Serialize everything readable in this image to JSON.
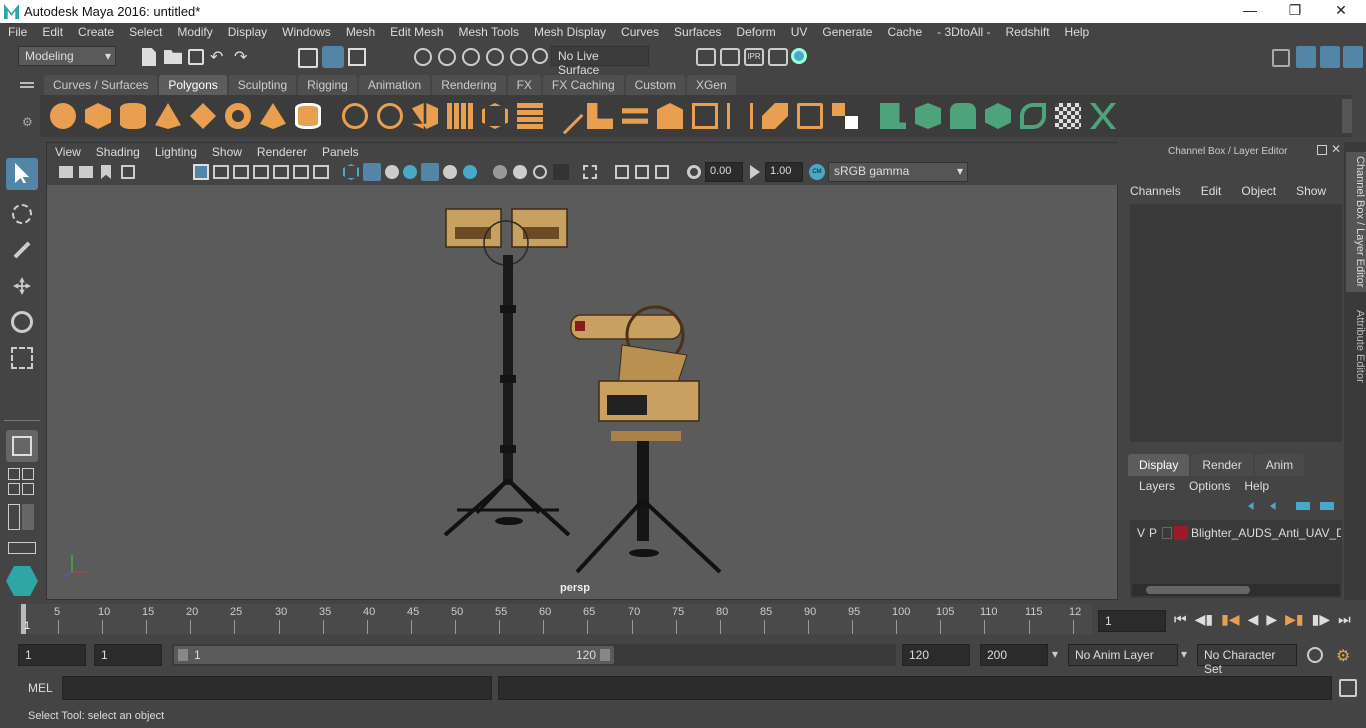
{
  "app": {
    "title": "Autodesk Maya 2016: untitled*"
  },
  "menus": [
    "File",
    "Edit",
    "Create",
    "Select",
    "Modify",
    "Display",
    "Windows",
    "Mesh",
    "Edit Mesh",
    "Mesh Tools",
    "Mesh Display",
    "Curves",
    "Surfaces",
    "Deform",
    "UV",
    "Generate",
    "Cache",
    "- 3DtoAll -",
    "Redshift",
    "Help"
  ],
  "status": {
    "mode": "Modeling",
    "live_surface": "No Live Surface"
  },
  "shelf_tabs": [
    "Curves / Surfaces",
    "Polygons",
    "Sculpting",
    "Rigging",
    "Animation",
    "Rendering",
    "FX",
    "FX Caching",
    "Custom",
    "XGen"
  ],
  "shelf_active": "Polygons",
  "viewport": {
    "menus": [
      "View",
      "Shading",
      "Lighting",
      "Show",
      "Renderer",
      "Panels"
    ],
    "exposure": "0.00",
    "gamma": "1.00",
    "color_space": "sRGB gamma",
    "camera_label": "persp"
  },
  "channel_box": {
    "title": "Channel Box / Layer Editor",
    "menus": [
      "Channels",
      "Edit",
      "Object",
      "Show"
    ]
  },
  "layer_editor": {
    "tabs": [
      "Display",
      "Render",
      "Anim"
    ],
    "active_tab": "Display",
    "menus": [
      "Layers",
      "Options",
      "Help"
    ],
    "layers": [
      {
        "v": "V",
        "p": "P",
        "name": "Blighter_AUDS_Anti_UAV_Def",
        "color": "#9b1b2a"
      }
    ]
  },
  "side_tabs": [
    "Channel Box / Layer Editor",
    "Attribute Editor"
  ],
  "timeline": {
    "ticks": [
      "5",
      "10",
      "15",
      "20",
      "25",
      "30",
      "35",
      "40",
      "45",
      "50",
      "55",
      "60",
      "65",
      "70",
      "75",
      "80",
      "85",
      "90",
      "95",
      "100",
      "105",
      "110",
      "115",
      "12"
    ],
    "current_frame_marker": "1",
    "current_frame": "1"
  },
  "range": {
    "start": "1",
    "anim_start": "1",
    "slider_start": "1",
    "slider_end": "120",
    "end": "120",
    "anim_end": "200",
    "anim_layer": "No Anim Layer",
    "character_set": "No Character Set"
  },
  "mel": {
    "label": "MEL"
  },
  "help_line": "Select Tool: select an object",
  "colors": {
    "accent_blue": "#5285a6",
    "shelf_orange": "#e8a050",
    "shelf_green": "#4da37a",
    "layer_red": "#9b1b2a"
  }
}
